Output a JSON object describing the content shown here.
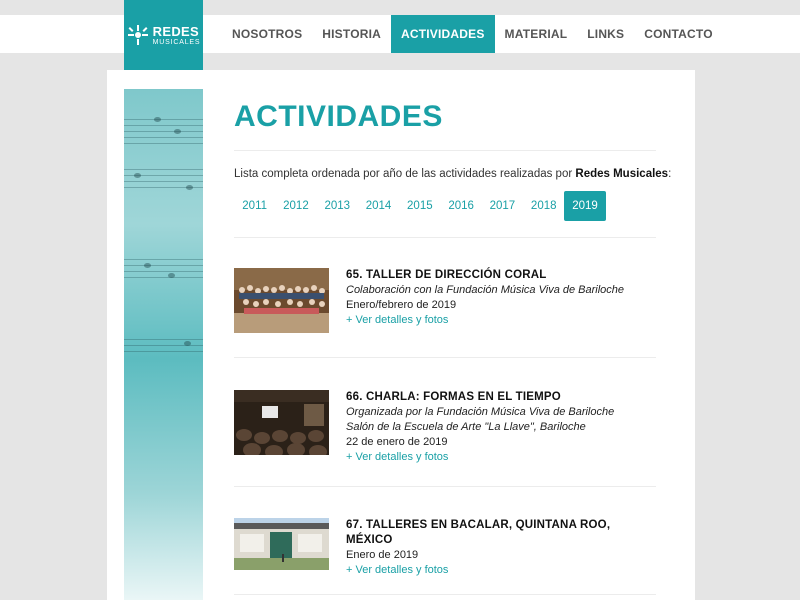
{
  "logo": {
    "line1": "REDES",
    "line2": "MUSICALES"
  },
  "nav": [
    {
      "label": "NOSOTROS"
    },
    {
      "label": "HISTORIA"
    },
    {
      "label": "ACTIVIDADES"
    },
    {
      "label": "MATERIAL"
    },
    {
      "label": "LINKS"
    },
    {
      "label": "CONTACTO"
    }
  ],
  "page": {
    "title": "ACTIVIDADES",
    "intro_prefix": "Lista completa ordenada por año de las actividades realizadas por ",
    "intro_bold": "Redes Musicales",
    "intro_suffix": ":"
  },
  "years": [
    "2011",
    "2012",
    "2013",
    "2014",
    "2015",
    "2016",
    "2017",
    "2018",
    "2019"
  ],
  "selected_year": "2019",
  "activities": [
    {
      "title": "65. TALLER DE DIRECCIÓN CORAL",
      "italic": [
        "Colaboración con la Fundación Música Viva de Bariloche"
      ],
      "date": "Enero/febrero de 2019",
      "link": "+ Ver detalles y fotos"
    },
    {
      "title": "66. CHARLA: FORMAS EN EL TIEMPO",
      "italic": [
        "Organizada por la Fundación Música Viva de Bariloche",
        "Salón de la Escuela de Arte \"La Llave\", Bariloche"
      ],
      "date": "22 de enero de 2019",
      "link": "+ Ver detalles y fotos"
    },
    {
      "title": "67. TALLERES EN BACALAR, QUINTANA ROO, MÉXICO",
      "italic": [],
      "date": "Enero de 2019",
      "link": "+ Ver detalles y fotos"
    }
  ],
  "colors": {
    "accent": "#1aa0a6",
    "background": "#e5e5e5"
  }
}
